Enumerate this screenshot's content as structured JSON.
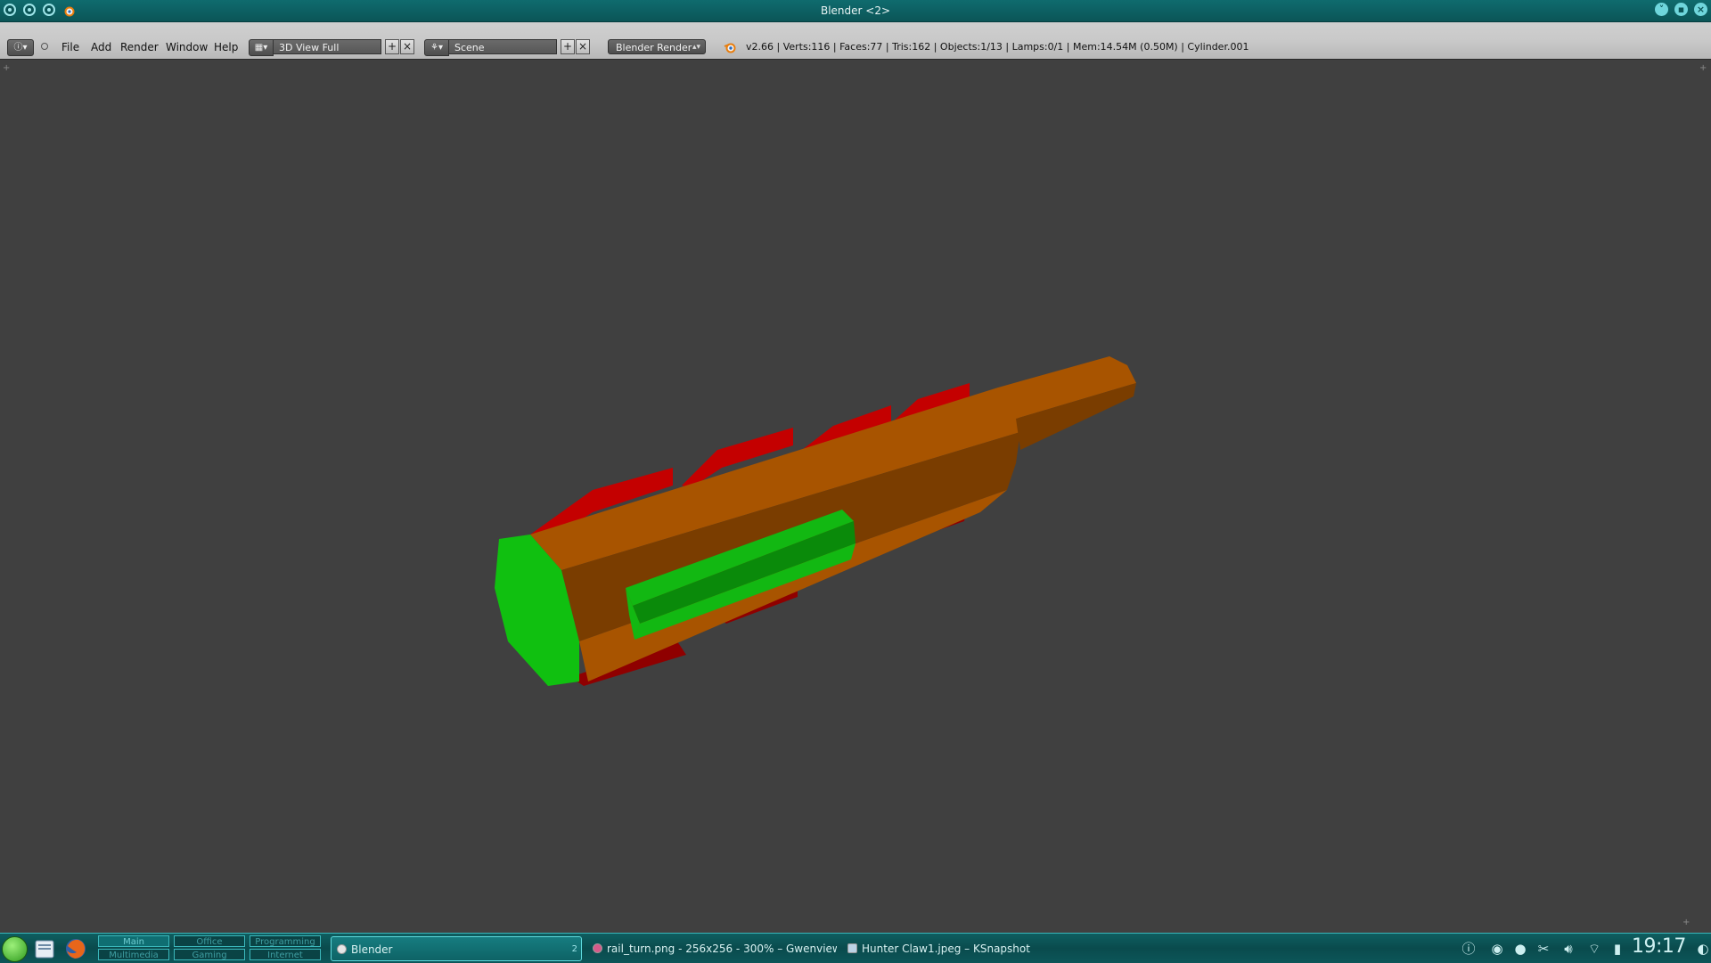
{
  "window": {
    "title": "Blender <2>"
  },
  "header": {
    "editor_type_icon": "info-editor-icon",
    "menus": [
      "File",
      "Add",
      "Render",
      "Window",
      "Help"
    ],
    "screen_layout": "3D View Full",
    "scene": "Scene",
    "render_engine": "Blender Render",
    "stats": "v2.66 | Verts:116 | Faces:77 | Tris:162 | Objects:1/13 | Lamps:0/1 | Mem:14.54M (0.50M) | Cylinder.001"
  },
  "viewport": {
    "object_name": "Cylinder.001",
    "colors": {
      "background": "#404040",
      "body_top": "#a85400",
      "body_side": "#7a3d00",
      "fins": "#c40000",
      "fins_dark": "#8f0000",
      "end_cap": "#10c010",
      "rail": "#12b812",
      "rail_dark": "#0a8a0a"
    }
  },
  "taskbar": {
    "pager": {
      "desktops": [
        "Main",
        "Office",
        "Programming",
        "Multimedia",
        "Gaming",
        "Internet"
      ]
    },
    "tasks": [
      {
        "label": "Blender",
        "count": "2",
        "active": true
      },
      {
        "label": "rail_turn.png - 256x256 - 300% – Gwenview",
        "active": false
      },
      {
        "label": "Hunter Claw1.jpeg – KSnapshot",
        "active": false
      }
    ],
    "clock": "19:17"
  }
}
